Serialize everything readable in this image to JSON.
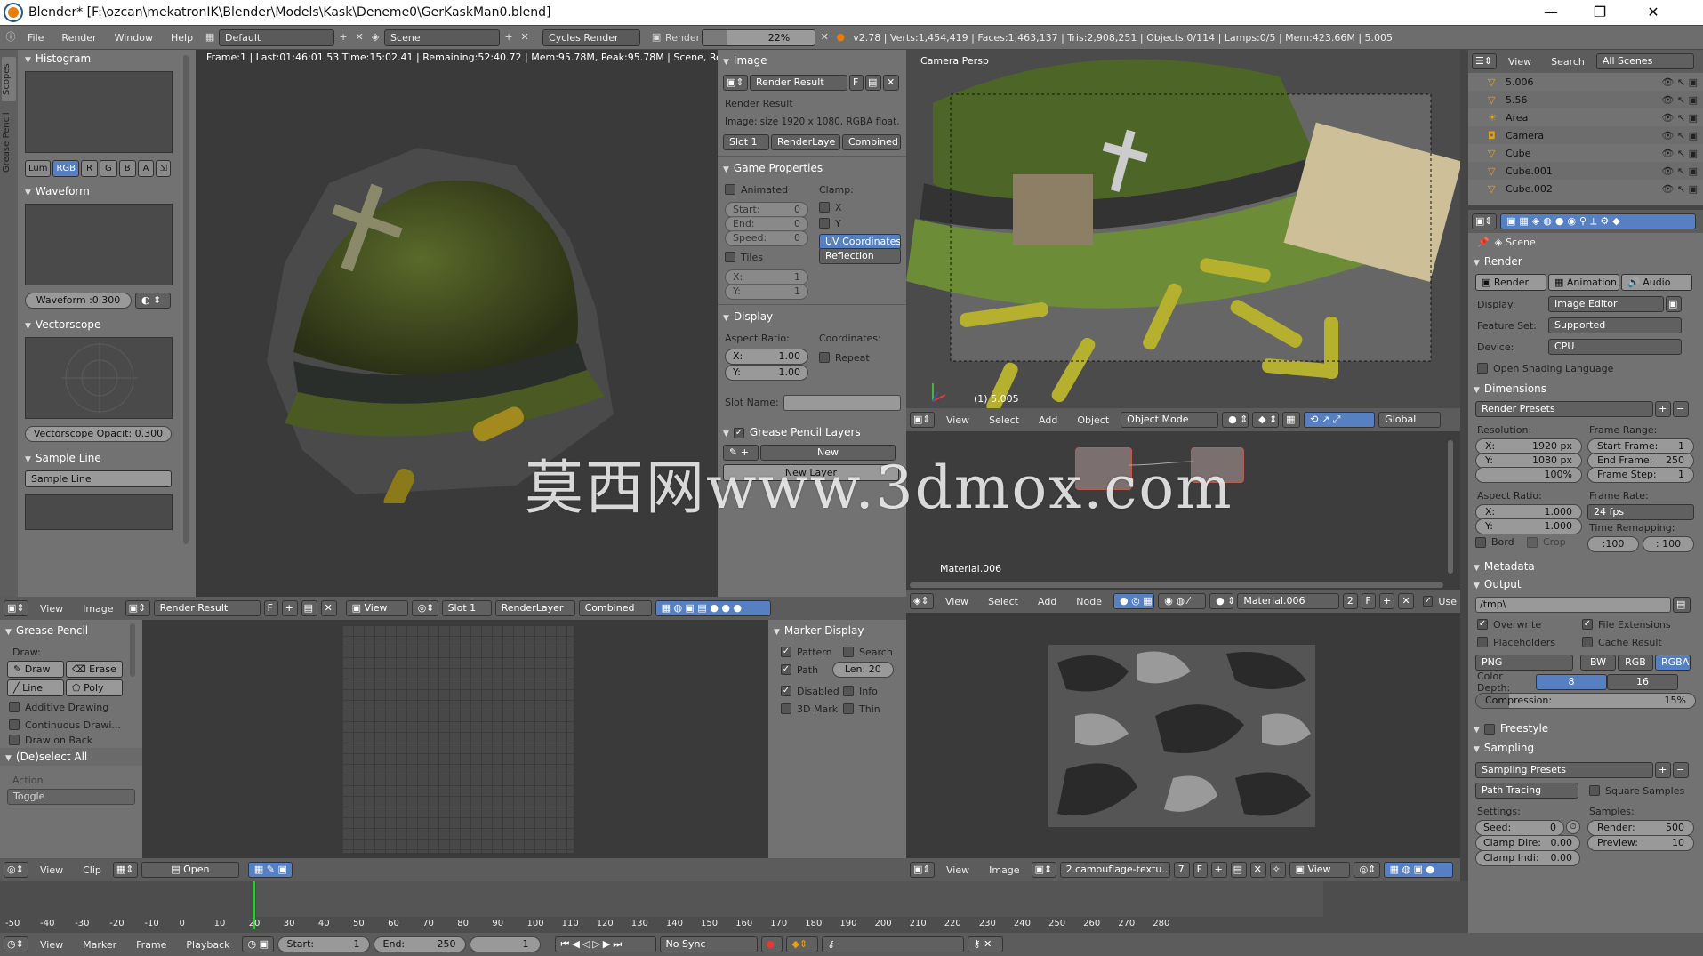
{
  "window": {
    "title": "Blender* [F:\\ozcan\\mekatronIK\\Blender\\Models\\Kask\\Deneme0\\GerKaskMan0.blend]",
    "minimize": "—",
    "maximize": "❐",
    "close": "✕"
  },
  "topbar": {
    "menus": [
      "File",
      "Render",
      "Window",
      "Help"
    ],
    "layout": "Default",
    "scene": "Scene",
    "engine": "Cycles Render",
    "render_label": "Render",
    "progress_text": "22%",
    "progress": 0.22,
    "stats": "v2.78 | Verts:1,454,419 | Faces:1,463,137 | Tris:2,908,251 | Objects:0/114 | Lamps:0/5 | Mem:423.66M | 5.005"
  },
  "scopes": {
    "vtab1": "Scopes",
    "vtab2": "Grease Pencil",
    "histogram": "Histogram",
    "channels": [
      "Lum",
      "RGB",
      "R",
      "G",
      "B",
      "A"
    ],
    "waveform": "Waveform",
    "waveform_field": "Waveform :0.300",
    "vectorscope": "Vectorscope",
    "vectorscope_field": "Vectorscope Opacit: 0.300",
    "sample_line": "Sample Line",
    "sample_line_btn": "Sample Line"
  },
  "render_view": {
    "status": "Frame:1 | Last:01:46:01.53 Time:15:02.41 | Remaining:52:40.72 | Mem:95.78M, Peak:95.78M | Scene, RenderLa"
  },
  "image_props": {
    "image": "Image",
    "render_result": "Render Result",
    "f": "F",
    "info_title": "Render Result",
    "info": "Image: size 1920 x 1080, RGBA float...",
    "slot": "Slot 1",
    "layer": "RenderLaye",
    "pass": "Combined",
    "game": "Game Properties",
    "animated": "Animated",
    "clamp": "Clamp:",
    "start": "Start:",
    "start_v": "0",
    "end": "End:",
    "end_v": "0",
    "speed": "Speed:",
    "speed_v": "0",
    "cx": "X",
    "cy": "Y",
    "uv": "UV Coordinates",
    "reflection": "Reflection",
    "tiles": "Tiles",
    "tx": "X:",
    "tx_v": "1",
    "ty": "Y:",
    "ty_v": "1",
    "display": "Display",
    "aspect": "Aspect Ratio:",
    "coords": "Coordinates:",
    "ax": "X:",
    "ax_v": "1.00",
    "ay": "Y:",
    "ay_v": "1.00",
    "repeat": "Repeat",
    "slot_name": "Slot Name:",
    "gp_layers": "Grease Pencil Layers",
    "new": "New",
    "new_layer": "New Layer"
  },
  "viewport": {
    "label": "Camera Persp",
    "frame": "(1) 5.005",
    "menus": [
      "View",
      "Select",
      "Add",
      "Object"
    ],
    "mode": "Object Mode",
    "orient": "Global"
  },
  "node_editor": {
    "material": "Material.006",
    "menus": [
      "View",
      "Select",
      "Add",
      "Node"
    ],
    "mat_field": "Material.006",
    "users": "2",
    "f": "F",
    "use": "Use"
  },
  "outliner": {
    "view": "View",
    "search": "Search",
    "scenes": "All Scenes",
    "items": [
      {
        "name": "5.006",
        "icon": "mesh-icon"
      },
      {
        "name": "5.56",
        "icon": "mesh-icon"
      },
      {
        "name": "Area",
        "icon": "lamp-icon"
      },
      {
        "name": "Camera",
        "icon": "camera-icon"
      },
      {
        "name": "Cube",
        "icon": "mesh-icon"
      },
      {
        "name": "Cube.001",
        "icon": "mesh-icon"
      },
      {
        "name": "Cube.002",
        "icon": "mesh-icon"
      }
    ]
  },
  "properties": {
    "scene": "Scene",
    "render": "Render",
    "render_btn": "Render",
    "anim_btn": "Animation",
    "audio_btn": "Audio",
    "display": "Display:",
    "display_v": "Image Editor",
    "feature": "Feature Set:",
    "feature_v": "Supported",
    "device": "Device:",
    "device_v": "CPU",
    "osl": "Open Shading Language",
    "dimensions": "Dimensions",
    "presets": "Render Presets",
    "resolution": "Resolution:",
    "frame_range": "Frame Range:",
    "rx": "X:",
    "rx_v": "1920 px",
    "ry": "Y:",
    "ry_v": "1080 px",
    "pct": "100%",
    "sf": "Start Frame:",
    "sf_v": "1",
    "ef": "End Frame:",
    "ef_v": "250",
    "fs": "Frame Step:",
    "fs_v": "1",
    "aspect": "Aspect Ratio:",
    "frame_rate": "Frame Rate:",
    "asx": "X:",
    "asx_v": "1.000",
    "asy": "Y:",
    "asy_v": "1.000",
    "fps": "24 fps",
    "remap": "Time Remapping:",
    "remap_a": ":100",
    "remap_b": ": 100",
    "bord": "Bord",
    "crop": "Crop",
    "metadata": "Metadata",
    "output": "Output",
    "path": "/tmp\\",
    "overwrite": "Overwrite",
    "file_ext": "File Extensions",
    "placeholders": "Placeholders",
    "cache": "Cache Result",
    "format": "PNG",
    "bw": "BW",
    "rgb": "RGB",
    "rgba": "RGBA",
    "depth": "Color Depth:",
    "d8": "8",
    "d16": "16",
    "compression": "Compression:",
    "comp_v": "15%",
    "comp": 0.15,
    "freestyle": "Freestyle",
    "sampling": "Sampling",
    "samp_presets": "Sampling Presets",
    "path_tracing": "Path Tracing",
    "square": "Square Samples",
    "settings": "Settings:",
    "samples": "Samples:",
    "seed": "Seed:",
    "seed_v": "0",
    "render_s": "Render:",
    "render_v": "500",
    "clamp_d": "Clamp Dire:",
    "clamp_d_v": "0.00",
    "preview": "Preview:",
    "preview_v": "10",
    "clamp_i": "Clamp Indi:",
    "clamp_i_v": "0.00"
  },
  "image_header": {
    "menus": [
      "View",
      "Image"
    ],
    "name": "Render Result",
    "f": "F",
    "view": "View",
    "slot": "Slot 1",
    "layer": "RenderLayer",
    "pass": "Combined"
  },
  "grease": {
    "title": "Grease Pencil",
    "draw": "Draw:",
    "draw_btn": "Draw",
    "erase": "Erase",
    "line": "Line",
    "poly": "Poly",
    "additive": "Additive Drawing",
    "continuous": "Continuous Drawi...",
    "back": "Draw on Back",
    "deselect": "(De)select All",
    "action": "Action",
    "toggle": "Toggle"
  },
  "marker": {
    "title": "Marker Display",
    "pattern": "Pattern",
    "search": "Search",
    "path": "Path",
    "len": "Len: 20",
    "disabled": "Disabled",
    "info": "Info",
    "mark3d": "3D Mark",
    "thin": "Thin"
  },
  "clip_header": {
    "menus": [
      "View",
      "Clip"
    ],
    "open": "Open"
  },
  "tex_header": {
    "menus": [
      "View",
      "Image"
    ],
    "name": "2.camouflage-textu...",
    "users": "7",
    "f": "F",
    "view": "View"
  },
  "timeline": {
    "ticks": [
      "-50",
      "-40",
      "-30",
      "-20",
      "-10",
      "0",
      "10",
      "20",
      "30",
      "40",
      "50",
      "60",
      "70",
      "80",
      "90",
      "100",
      "110",
      "120",
      "130",
      "140",
      "150",
      "160",
      "170",
      "180",
      "190",
      "200",
      "210",
      "220",
      "230",
      "240",
      "250",
      "260",
      "270",
      "280"
    ],
    "menus": [
      "View",
      "Marker",
      "Frame",
      "Playback"
    ],
    "start": "Start:",
    "start_v": "1",
    "end": "End:",
    "end_v": "250",
    "current": "1",
    "sync": "No Sync"
  },
  "watermark": "莫西网www.3dmox.com"
}
